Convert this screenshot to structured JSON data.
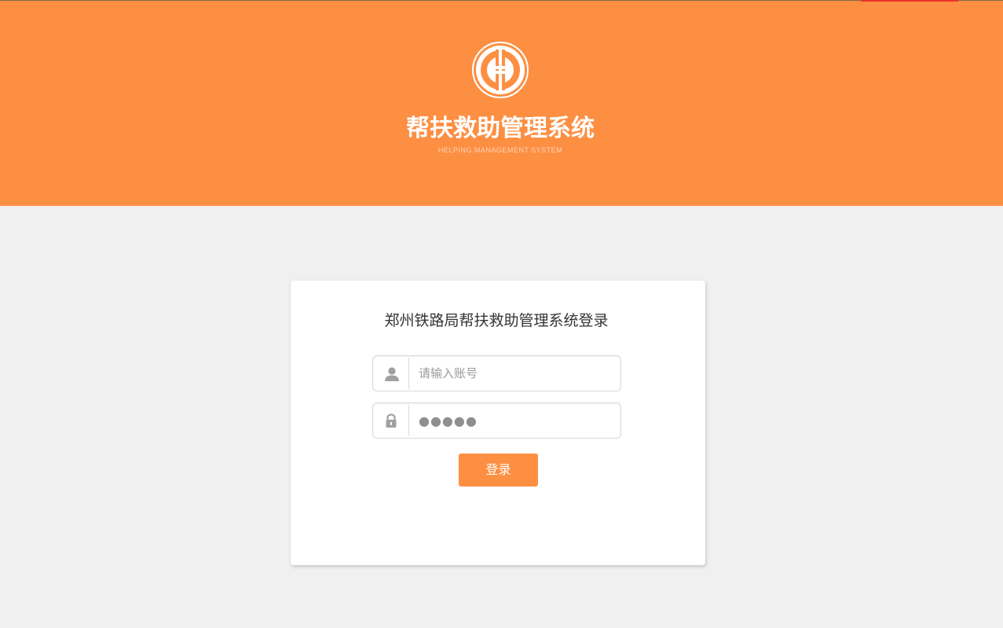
{
  "header": {
    "title": "帮扶救助管理系统",
    "subtitle": "HELPING MANAGEMENT SYSTEM",
    "logo_icon": "union-emblem-icon",
    "background_color": "#fd8f43"
  },
  "login": {
    "heading": "郑州铁路局帮扶救助管理系统登录",
    "username": {
      "icon": "user-icon",
      "placeholder": "请输入账号",
      "value": ""
    },
    "password": {
      "icon": "lock-icon",
      "value": "●●●●●"
    },
    "submit_label": "登录",
    "accent_color": "#fd8f43"
  }
}
